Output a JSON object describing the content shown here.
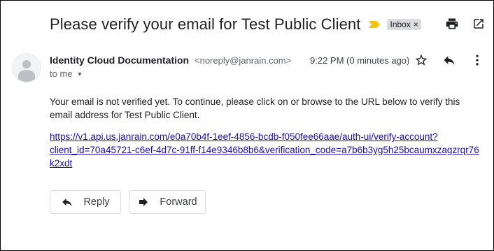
{
  "header": {
    "subject": "Please verify your email for Test Public Client",
    "label": "Inbox",
    "label_close": "×"
  },
  "message": {
    "sender_name": "Identity Cloud Documentation",
    "sender_email": "<noreply@janrain.com>",
    "recipient": "to me",
    "timestamp": "9:22 PM (0 minutes ago)",
    "body": "Your email is not verified yet. To continue, please click on or browse to the URL below to verify this email address for Test Public Client.",
    "link_line1": "https://v1.api.us.janrain.com/e0a70b4f-1eef-4856-bcdb-f050fee66aae/auth-ui/verify-account?",
    "link_line2": "client_id=70a45721-c6ef-4d7c-91ff-f14e9346b8b6&verification_code=a7b6b3yg5h25bcaumxzagzrqr76k2xdt"
  },
  "actions": {
    "reply_label": "Reply",
    "forward_label": "Forward"
  },
  "icons": {
    "importance": "importance-marker-icon",
    "print": "print-icon",
    "new_window": "open-in-new-window-icon",
    "avatar": "person-avatar-icon",
    "star": "star-icon",
    "reply": "reply-icon",
    "more": "more-vert-icon",
    "forward": "forward-icon"
  },
  "colors": {
    "importance": "#f4c20d",
    "link": "#1a0dab",
    "chip_bg": "#dadce0"
  }
}
